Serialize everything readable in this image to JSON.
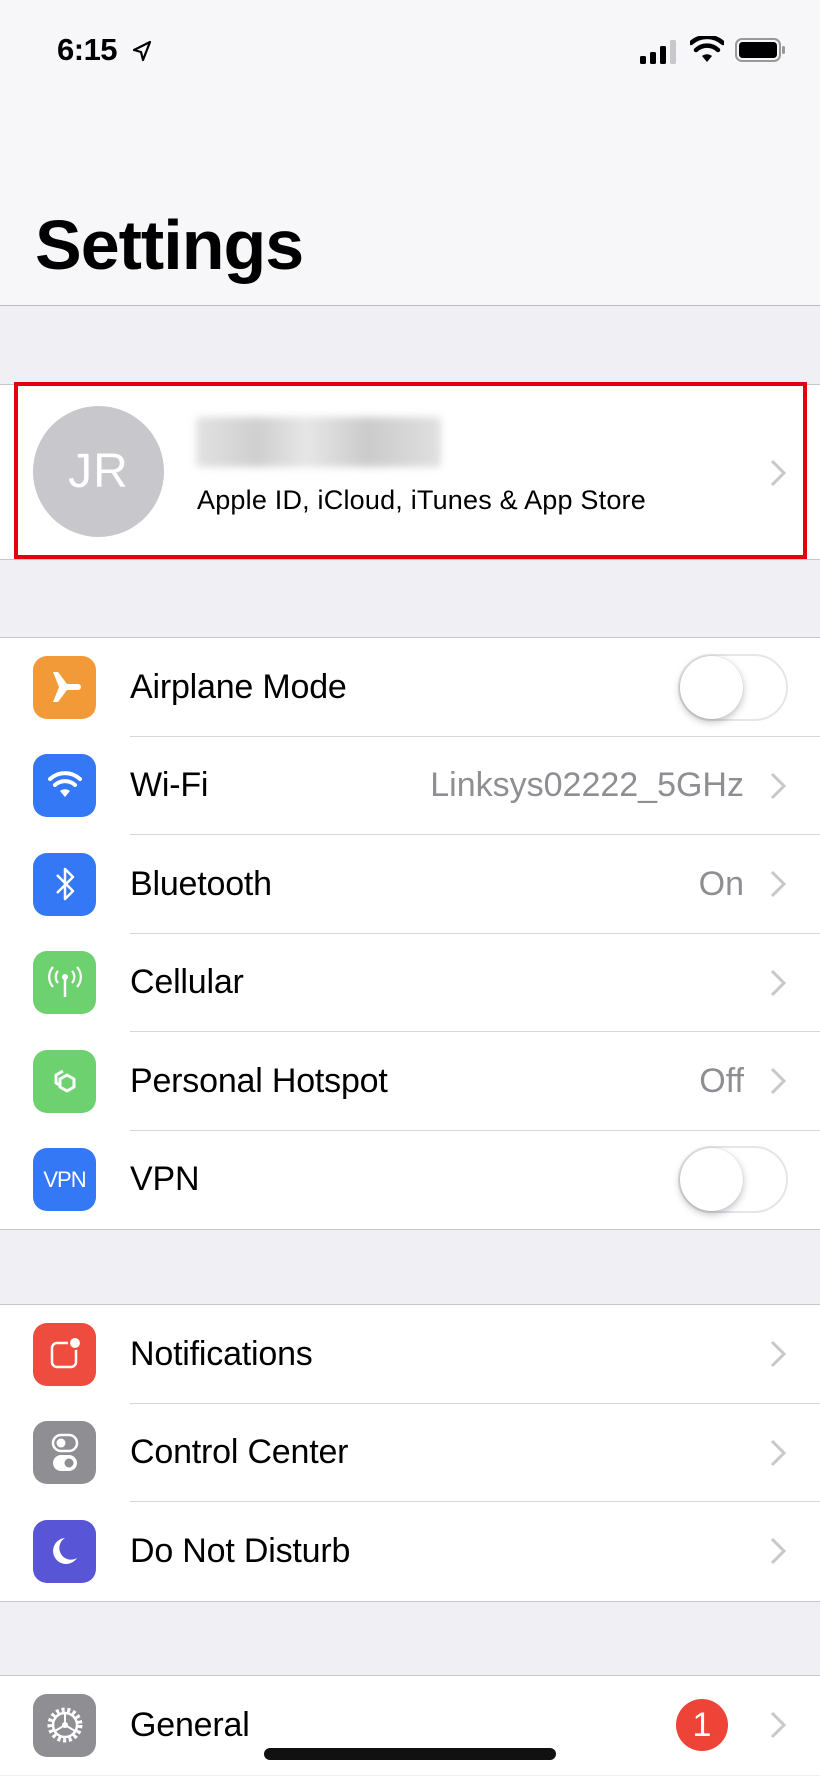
{
  "status_bar": {
    "time": "6:15",
    "icons": [
      "location-arrow-icon",
      "cellular-signal-icon",
      "wifi-icon",
      "battery-icon"
    ]
  },
  "header": {
    "title": "Settings"
  },
  "profile": {
    "initials": "JR",
    "name": "(blurred)",
    "subtitle": "Apple ID, iCloud, iTunes & App Store"
  },
  "groups": [
    {
      "rows": [
        {
          "label": "Airplane Mode",
          "icon": "airplane-icon",
          "color": "#f29a38",
          "control": "toggle",
          "toggle_on": false
        },
        {
          "label": "Wi-Fi",
          "icon": "wifi-icon",
          "color": "#3478f6",
          "value": "Linksys02222_5GHz",
          "control": "chevron"
        },
        {
          "label": "Bluetooth",
          "icon": "bluetooth-icon",
          "color": "#3478f6",
          "value": "On",
          "control": "chevron"
        },
        {
          "label": "Cellular",
          "icon": "cellular-antenna-icon",
          "color": "#6dd16f",
          "control": "chevron"
        },
        {
          "label": "Personal Hotspot",
          "icon": "hotspot-icon",
          "color": "#6dd16f",
          "value": "Off",
          "control": "chevron"
        },
        {
          "label": "VPN",
          "icon": "vpn-icon",
          "icon_text": "VPN",
          "color": "#3478f6",
          "control": "toggle",
          "toggle_on": false
        }
      ]
    },
    {
      "rows": [
        {
          "label": "Notifications",
          "icon": "notifications-icon",
          "color": "#ee4c3e",
          "control": "chevron"
        },
        {
          "label": "Control Center",
          "icon": "control-center-icon",
          "color": "#8e8e93",
          "control": "chevron"
        },
        {
          "label": "Do Not Disturb",
          "icon": "moon-icon",
          "color": "#5856d6",
          "control": "chevron"
        }
      ]
    },
    {
      "rows": [
        {
          "label": "General",
          "icon": "gear-icon",
          "color": "#8e8e93",
          "badge": "1",
          "control": "chevron"
        }
      ]
    }
  ],
  "colors": {
    "highlight": "#e3000f",
    "badge": "#ee4438",
    "secondary_text": "#8e8e93",
    "background": "#efeff4"
  }
}
